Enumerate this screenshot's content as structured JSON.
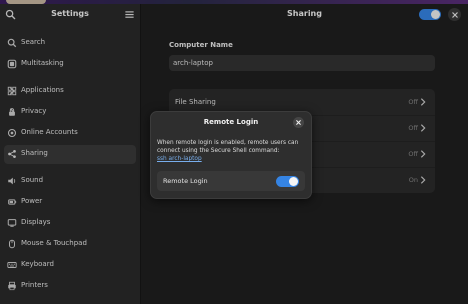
{
  "sidebar": {
    "title": "Settings",
    "items": [
      {
        "label": "Search",
        "icon": "search-icon"
      },
      {
        "label": "Multitasking",
        "icon": "multitasking-icon"
      },
      {
        "label": "Applications",
        "icon": "applications-icon",
        "has_chevron": true
      },
      {
        "label": "Privacy",
        "icon": "privacy-icon",
        "has_chevron": true
      },
      {
        "label": "Online Accounts",
        "icon": "online-accounts-icon"
      },
      {
        "label": "Sharing",
        "icon": "sharing-icon",
        "active": true
      },
      {
        "label": "Sound",
        "icon": "sound-icon"
      },
      {
        "label": "Power",
        "icon": "power-icon"
      },
      {
        "label": "Displays",
        "icon": "displays-icon"
      },
      {
        "label": "Mouse & Touchpad",
        "icon": "mouse-icon"
      },
      {
        "label": "Keyboard",
        "icon": "keyboard-icon"
      },
      {
        "label": "Printers",
        "icon": "printer-icon"
      }
    ]
  },
  "main": {
    "title": "Sharing",
    "sharing_enabled": true,
    "computer_name": {
      "label": "Computer Name",
      "value": "arch-laptop"
    },
    "rows": [
      {
        "label": "File Sharing",
        "status": "Off"
      },
      {
        "label": "",
        "status": "Off"
      },
      {
        "label": "",
        "status": "Off"
      },
      {
        "label": "",
        "status": "On"
      }
    ]
  },
  "dialog": {
    "title": "Remote Login",
    "description": "When remote login is enabled, remote users can connect using the Secure Shell command:",
    "command": "ssh arch-laptop",
    "toggle_label": "Remote Login",
    "toggle_on": true
  },
  "colors": {
    "accent": "#3584e4",
    "link": "#78aeed"
  }
}
